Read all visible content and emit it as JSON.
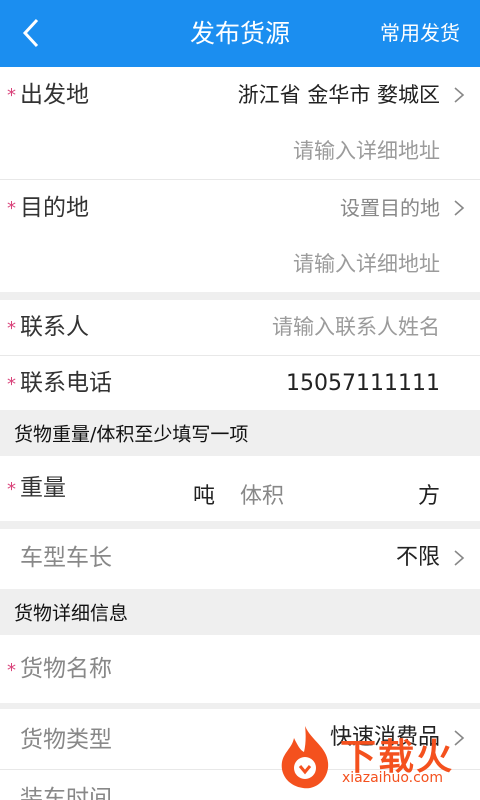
{
  "header": {
    "title": "发布货源",
    "action": "常用发货"
  },
  "origin": {
    "label": "出发地",
    "value": "浙江省 金华市 婺城区",
    "detail_placeholder": "请输入详细地址"
  },
  "destination": {
    "label": "目的地",
    "value": "设置目的地",
    "detail_placeholder": "请输入详细地址"
  },
  "contact": {
    "name_label": "联系人",
    "name_placeholder": "请输入联系人姓名",
    "phone_label": "联系电话",
    "phone_value": "15057111111"
  },
  "section_weight": "货物重量/体积至少填写一项",
  "weight": {
    "label": "重量",
    "unit": "吨",
    "volume_label": "体积",
    "volume_unit": "方"
  },
  "vehicle": {
    "label": "车型车长",
    "value": "不限"
  },
  "section_details": "货物详细信息",
  "cargo": {
    "name_label": "货物名称",
    "type_label": "货物类型",
    "type_value": "快速消费品",
    "load_time_label": "装车时间"
  },
  "required_mark": "*",
  "watermark": {
    "brand": "下载火",
    "site": "xiazaihuo.com"
  },
  "colors": {
    "header": "#1b8ef0",
    "required": "#d9437a",
    "section_bg": "#efefef"
  }
}
